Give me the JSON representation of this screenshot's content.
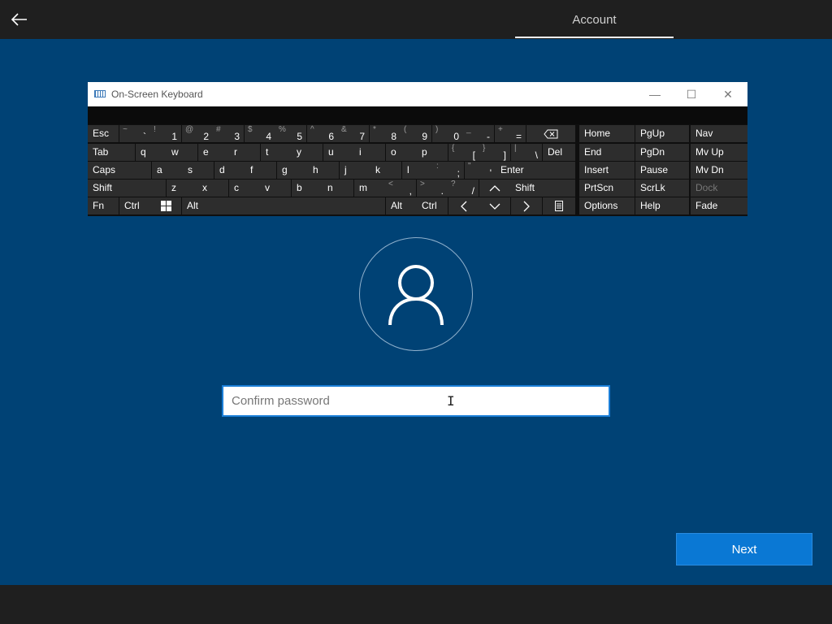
{
  "header": {
    "tab_label": "Account"
  },
  "osk": {
    "title": "On-Screen Keyboard",
    "window_buttons": {
      "minimize": "—",
      "maximize": "☐",
      "close": "✕"
    },
    "rows": [
      [
        {
          "label": "Esc"
        },
        {
          "shift": "~",
          "main": "`"
        },
        {
          "shift": "!",
          "main": "1"
        },
        {
          "shift": "@",
          "main": "2"
        },
        {
          "shift": "#",
          "main": "3"
        },
        {
          "shift": "$",
          "main": "4"
        },
        {
          "shift": "%",
          "main": "5"
        },
        {
          "shift": "^",
          "main": "6"
        },
        {
          "shift": "&",
          "main": "7"
        },
        {
          "shift": "*",
          "main": "8"
        },
        {
          "shift": "(",
          "main": "9"
        },
        {
          "shift": ")",
          "main": "0"
        },
        {
          "shift": "_",
          "main": "-"
        },
        {
          "shift": "+",
          "main": "="
        },
        {
          "icon": "backspace-icon"
        },
        {
          "label": "Home"
        },
        {
          "label": "PgUp"
        },
        {
          "label": "Nav"
        }
      ],
      [
        {
          "label": "Tab"
        },
        {
          "label": "q"
        },
        {
          "label": "w"
        },
        {
          "label": "e"
        },
        {
          "label": "r"
        },
        {
          "label": "t"
        },
        {
          "label": "y"
        },
        {
          "label": "u"
        },
        {
          "label": "i"
        },
        {
          "label": "o"
        },
        {
          "label": "p"
        },
        {
          "shift": "{",
          "main": "["
        },
        {
          "shift": "}",
          "main": "]"
        },
        {
          "shift": "|",
          "main": "\\"
        },
        {
          "label": "Del"
        },
        {
          "label": "End"
        },
        {
          "label": "PgDn"
        },
        {
          "label": "Mv Up"
        }
      ],
      [
        {
          "label": "Caps"
        },
        {
          "label": "a"
        },
        {
          "label": "s"
        },
        {
          "label": "d"
        },
        {
          "label": "f"
        },
        {
          "label": "g"
        },
        {
          "label": "h"
        },
        {
          "label": "j"
        },
        {
          "label": "k"
        },
        {
          "label": "l"
        },
        {
          "shift": ":",
          "main": ";"
        },
        {
          "shift": "\"",
          "main": "'"
        },
        {
          "label": "Enter"
        },
        {
          "label": "Insert"
        },
        {
          "label": "Pause"
        },
        {
          "label": "Mv Dn"
        }
      ],
      [
        {
          "label": "Shift"
        },
        {
          "label": "z"
        },
        {
          "label": "x"
        },
        {
          "label": "c"
        },
        {
          "label": "v"
        },
        {
          "label": "b"
        },
        {
          "label": "n"
        },
        {
          "label": "m"
        },
        {
          "shift": "<",
          "main": ","
        },
        {
          "shift": ">",
          "main": "."
        },
        {
          "shift": "?",
          "main": "/"
        },
        {
          "icon": "arrow-up-icon"
        },
        {
          "label": "Shift"
        },
        {
          "label": "PrtScn"
        },
        {
          "label": "ScrLk"
        },
        {
          "label": "Dock",
          "dim": true
        }
      ],
      [
        {
          "label": "Fn"
        },
        {
          "label": "Ctrl"
        },
        {
          "icon": "windows-icon"
        },
        {
          "label": "Alt"
        },
        {
          "label": ""
        },
        {
          "label": "Alt"
        },
        {
          "label": "Ctrl"
        },
        {
          "icon": "arrow-left-icon"
        },
        {
          "icon": "arrow-down-icon"
        },
        {
          "icon": "arrow-right-icon"
        },
        {
          "icon": "menu-icon"
        },
        {
          "label": "Options"
        },
        {
          "label": "Help"
        },
        {
          "label": "Fade"
        }
      ]
    ]
  },
  "password": {
    "placeholder": "Confirm password",
    "value": ""
  },
  "next_label": "Next",
  "colors": {
    "background": "#004275",
    "accent": "#0a78d4",
    "bar": "#1f1f1f"
  }
}
